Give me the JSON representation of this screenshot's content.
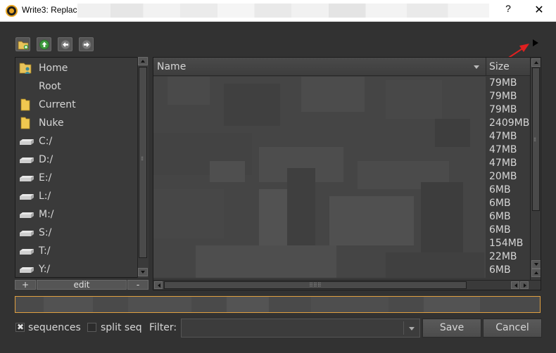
{
  "window": {
    "title": "Write3: Replace",
    "help_label": "?",
    "close_label": "✕"
  },
  "toolbar": {
    "buttons": [
      "new-folder-icon",
      "up-folder-icon",
      "back-icon",
      "forward-icon"
    ]
  },
  "favorites": {
    "items": [
      {
        "label": "Home",
        "icon": "home-folder-icon"
      },
      {
        "label": "Root",
        "icon": "none"
      },
      {
        "label": "Current",
        "icon": "folder-icon"
      },
      {
        "label": "Nuke",
        "icon": "folder-icon"
      },
      {
        "label": "C:/",
        "icon": "drive-icon"
      },
      {
        "label": "D:/",
        "icon": "drive-icon"
      },
      {
        "label": "E:/",
        "icon": "drive-icon"
      },
      {
        "label": "L:/",
        "icon": "drive-icon"
      },
      {
        "label": "M:/",
        "icon": "drive-icon"
      },
      {
        "label": "S:/",
        "icon": "drive-icon"
      },
      {
        "label": "T:/",
        "icon": "drive-icon"
      },
      {
        "label": "Y:/",
        "icon": "drive-icon"
      }
    ],
    "add_label": "+",
    "edit_label": "edit",
    "remove_label": "-"
  },
  "file_list": {
    "columns": {
      "name": "Name",
      "size": "Size"
    },
    "sizes": [
      "79MB",
      "79MB",
      "79MB",
      "2409MB",
      "47MB",
      "47MB",
      "47MB",
      "20MB",
      "6MB",
      "6MB",
      "6MB",
      "6MB",
      "154MB",
      "22MB",
      "6MB"
    ]
  },
  "filename": {
    "value": ""
  },
  "options": {
    "sequences_label": "sequences",
    "sequences_checked": true,
    "split_seq_label": "split seq",
    "split_seq_checked": false,
    "filter_label": "Filter:",
    "filter_value": ""
  },
  "actions": {
    "save_label": "Save",
    "cancel_label": "Cancel"
  },
  "colors": {
    "background": "#323232",
    "accent_border": "#e0a040",
    "annotation_arrow": "#e02020"
  }
}
